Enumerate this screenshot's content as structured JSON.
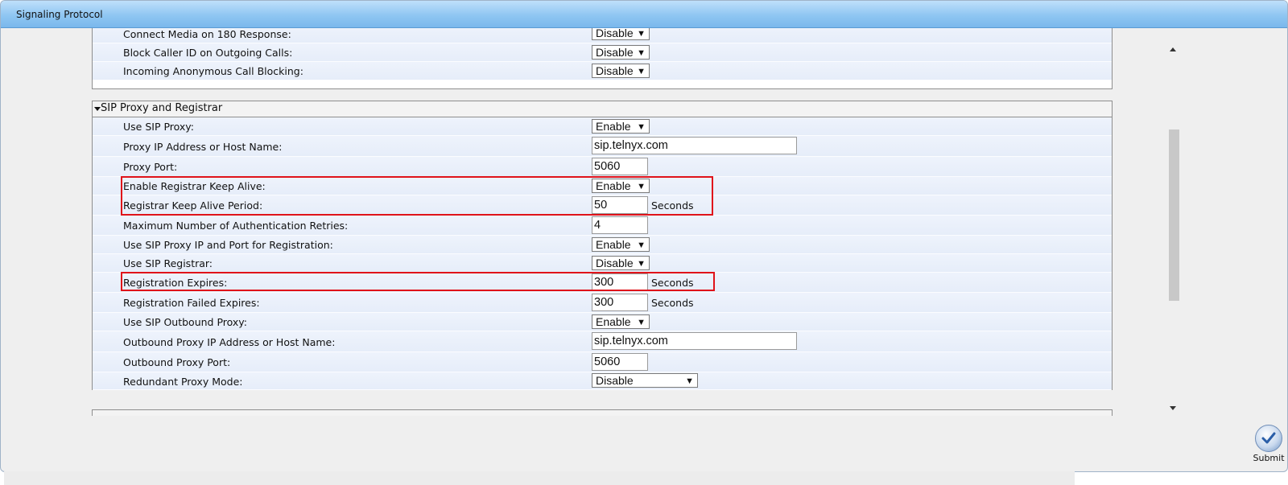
{
  "window": {
    "title": "Signaling Protocol"
  },
  "top_section": {
    "rows": [
      {
        "label": "Connect Media on 180 Response:",
        "control": "select",
        "value": "Disable"
      },
      {
        "label": "Block Caller ID on Outgoing Calls:",
        "control": "select",
        "value": "Disable"
      },
      {
        "label": "Incoming Anonymous Call Blocking:",
        "control": "select",
        "value": "Disable"
      }
    ]
  },
  "sip_section": {
    "title": "SIP Proxy and Registrar",
    "rows": [
      {
        "label": "Use SIP Proxy:",
        "control": "select",
        "value": "Enable"
      },
      {
        "label": "Proxy IP Address or Host Name:",
        "control": "input",
        "value": "sip.telnyx.com"
      },
      {
        "label": "Proxy Port:",
        "control": "input",
        "value": "5060"
      },
      {
        "label": "Enable Registrar Keep Alive:",
        "control": "select",
        "value": "Enable"
      },
      {
        "label": "Registrar Keep Alive Period:",
        "control": "input",
        "value": "50",
        "unit": "Seconds"
      },
      {
        "label": "Maximum Number of Authentication Retries:",
        "control": "input",
        "value": "4"
      },
      {
        "label": "Use SIP Proxy IP and Port for Registration:",
        "control": "select",
        "value": "Enable"
      },
      {
        "label": "Use SIP Registrar:",
        "control": "select",
        "value": "Disable"
      },
      {
        "label": "Registration Expires:",
        "control": "input",
        "value": "300",
        "unit": "Seconds"
      },
      {
        "label": "Registration Failed Expires:",
        "control": "input",
        "value": "300",
        "unit": "Seconds"
      },
      {
        "label": "Use SIP Outbound Proxy:",
        "control": "select",
        "value": "Enable"
      },
      {
        "label": "Outbound Proxy IP Address or Host Name:",
        "control": "input",
        "value": "sip.telnyx.com"
      },
      {
        "label": "Outbound Proxy Port:",
        "control": "input",
        "value": "5060"
      },
      {
        "label": "Redundant Proxy Mode:",
        "control": "select",
        "value": "Disable"
      }
    ]
  },
  "submit": {
    "label": "Submit"
  },
  "colors": {
    "highlight": "#e0131a",
    "row_bg": "#e9eff9",
    "titlebar": "#8fc6f2"
  }
}
